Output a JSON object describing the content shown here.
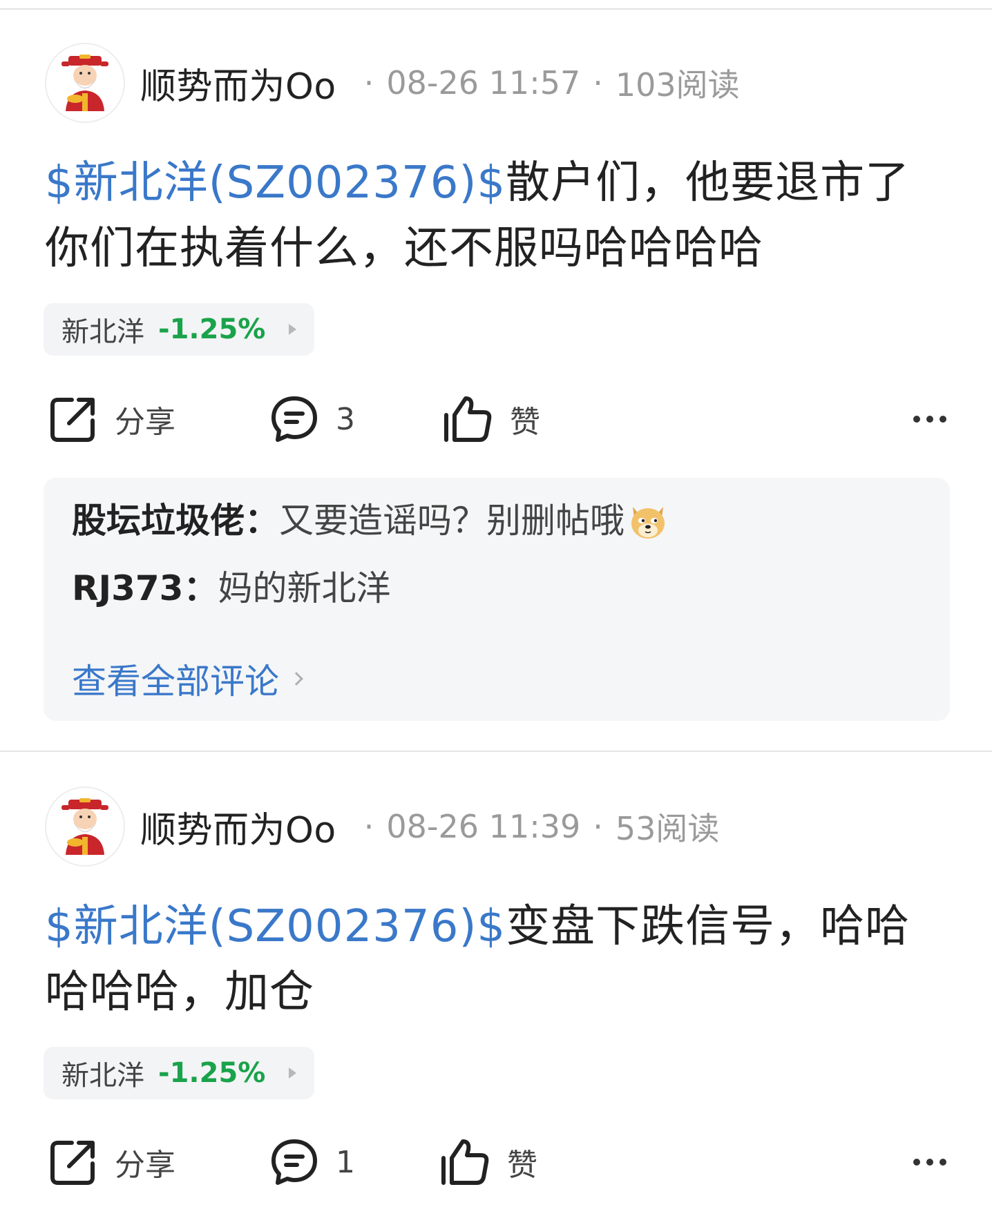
{
  "posts": [
    {
      "author": "顺势而为Oo",
      "sep": "·",
      "time": "08-26 11:57",
      "reads": "103阅读",
      "stock_link": "$新北洋(SZ002376)$",
      "body_line1": "散户们，他要退市了",
      "body_line2": "你们在执着什么，还不服吗哈哈哈哈",
      "chip": {
        "name": "新北洋",
        "change": "-1.25%"
      },
      "actions": {
        "share": "分享",
        "comments": "3",
        "like": "赞"
      },
      "comments": [
        {
          "user": "股坛垃圾佬",
          "colon": "：",
          "text": "又要造谣吗？别删帖哦"
        },
        {
          "user": "RJ373",
          "colon": "：",
          "text": "妈的新北洋"
        }
      ],
      "view_all": "查看全部评论"
    },
    {
      "author": "顺势而为Oo",
      "sep": "·",
      "time": "08-26 11:39",
      "reads": "53阅读",
      "stock_link": "$新北洋(SZ002376)$",
      "body_line1": "变盘下跌信号，哈哈",
      "body_line2": "哈哈哈，加仓",
      "chip": {
        "name": "新北洋",
        "change": "-1.25%"
      },
      "actions": {
        "share": "分享",
        "comments": "1",
        "like": "赞"
      }
    }
  ],
  "colors": {
    "link_blue": "#3a78c9",
    "down_green": "#1aa34a"
  },
  "icons": [
    "avatar-caishen",
    "share-icon",
    "comment-icon",
    "thumbs-up-icon",
    "more-icon",
    "doge-emoji",
    "chevron-right-icon"
  ]
}
